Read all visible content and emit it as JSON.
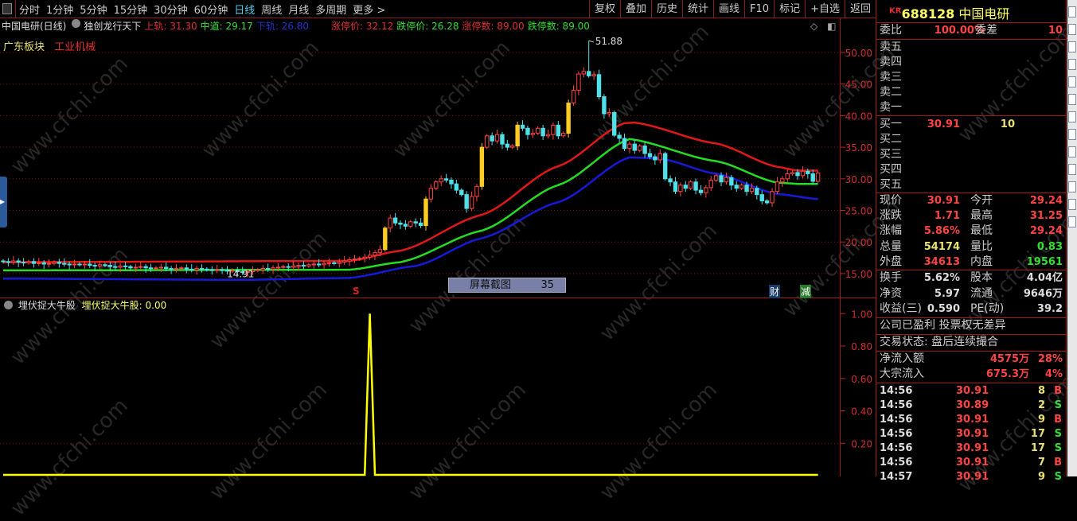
{
  "toolbar": {
    "periods": [
      "分时",
      "1分钟",
      "5分钟",
      "15分钟",
      "30分钟",
      "60分钟",
      "日线",
      "周线",
      "月线",
      "多周期",
      "更多 >"
    ],
    "active_period": "日线",
    "buttons": [
      "复权",
      "叠加",
      "历史",
      "统计",
      "画线",
      "F10",
      "标记",
      "+自选",
      "返回"
    ]
  },
  "legend": {
    "stock": "中国电研(日线)",
    "indicator": "独创龙行天下",
    "upper": "上轨: 31.30",
    "middle": "中道: 29.17",
    "lower": "下轨: 26.80",
    "limit_up": "涨停价: 32.12",
    "limit_down": "跌停价: 26.28",
    "limit_up_count": "涨停数: 89.00",
    "limit_down_count": "跌停数: 89.00"
  },
  "blocks": {
    "region": "广东板块",
    "industry": "工业机械"
  },
  "markers": {
    "s": "S",
    "screenshot_label": "屏幕截图",
    "screenshot_count": "35",
    "cai": "财",
    "jian": "减"
  },
  "lower_panel": {
    "name": "埋伏捉大牛股",
    "value_label": "埋伏捉大牛股: 0.00"
  },
  "watermark": "www.cfchi.com",
  "colors": {
    "up": "#ff4444",
    "down": "#4fe0e8",
    "big_up": "#ffcc22",
    "upper_band": "#e01818",
    "middle_band": "#22dd22",
    "lower_band": "#1818d8",
    "indicator": "#ffff00"
  },
  "chart_data": [
    {
      "type": "candlestick",
      "ylim": [
        13,
        53
      ],
      "y_ticks": [
        "50.00",
        "45.00",
        "40.00",
        "35.00",
        "30.00",
        "25.00",
        "20.00",
        "15.00"
      ],
      "close": [
        16.9,
        16.8,
        17.0,
        16.8,
        16.7,
        16.9,
        16.6,
        16.7,
        16.5,
        16.6,
        16.8,
        16.6,
        16.5,
        16.4,
        16.5,
        16.4,
        16.5,
        16.3,
        16.2,
        16.4,
        16.3,
        16.1,
        16.0,
        16.2,
        16.1,
        15.9,
        16.0,
        16.1,
        15.9,
        15.8,
        15.9,
        16.0,
        15.8,
        15.7,
        15.8,
        15.9,
        15.7,
        15.6,
        15.8,
        15.7,
        15.6,
        15.5,
        15.6,
        15.5,
        15.4,
        15.5,
        15.3,
        15.2,
        15.3,
        15.5,
        15.6,
        15.8,
        15.7,
        15.9,
        16.0,
        16.1,
        16.0,
        16.2,
        16.3,
        16.2,
        16.4,
        16.5,
        16.4,
        16.6,
        16.7,
        16.6,
        16.8,
        17.0,
        17.2,
        17.3,
        17.4,
        17.6,
        17.9,
        18.3,
        18.8,
        22.2,
        23.8,
        23.0,
        22.8,
        22.5,
        23.2,
        23.0,
        22.6,
        26.8,
        28.5,
        29.5,
        30.0,
        29.8,
        29.2,
        28.2,
        27.5,
        25.3,
        27.2,
        28.8,
        35.0,
        36.8,
        36.0,
        37.0,
        35.5,
        35.0,
        35.2,
        38.5,
        38.0,
        37.0,
        37.2,
        38.0,
        36.8,
        37.0,
        38.5,
        36.8,
        37.2,
        42.0,
        44.0,
        46.6,
        47.0,
        46.3,
        46.5,
        43.0,
        40.3,
        40.5,
        36.9,
        36.4,
        34.8,
        35.5,
        34.5,
        35.2,
        34.0,
        33.5,
        33.0,
        34.0,
        30.0,
        29.5,
        28.0,
        29.0,
        28.5,
        29.5,
        28.2,
        27.8,
        28.6,
        29.8,
        30.5,
        29.5,
        30.2,
        29.0,
        28.5,
        29.0,
        28.0,
        28.5,
        27.5,
        26.5,
        26.2,
        28.0,
        29.5,
        30.0,
        30.8,
        31.0,
        30.5,
        31.2,
        30.8,
        29.6,
        30.91
      ],
      "high_marker": {
        "index": 115,
        "value": 51.88,
        "label": "51.88"
      },
      "low_marker": {
        "index": 43,
        "value": 14.91,
        "label": "14.91"
      },
      "bands": {
        "upper": [
          [
            0,
            16.8
          ],
          [
            68,
            17.0
          ],
          [
            78,
            18.6
          ],
          [
            94,
            24.3
          ],
          [
            109,
            32
          ],
          [
            122,
            38.8
          ],
          [
            124,
            38.9
          ],
          [
            140,
            35.6
          ],
          [
            152,
            31.9
          ],
          [
            156,
            31.3
          ],
          [
            160,
            31.3
          ]
        ],
        "middle": [
          [
            0,
            15.5
          ],
          [
            68,
            15.6
          ],
          [
            78,
            16.8
          ],
          [
            94,
            21.8
          ],
          [
            109,
            29
          ],
          [
            123,
            36.3
          ],
          [
            140,
            32.8
          ],
          [
            152,
            29.4
          ],
          [
            156,
            29.2
          ],
          [
            160,
            29.2
          ]
        ],
        "lower": [
          [
            0,
            14.2
          ],
          [
            47,
            14.0
          ],
          [
            68,
            14.3
          ],
          [
            81,
            16.2
          ],
          [
            94,
            20.6
          ],
          [
            109,
            26.3
          ],
          [
            123,
            33.4
          ],
          [
            129,
            33.2
          ],
          [
            140,
            30.8
          ],
          [
            152,
            27.6
          ],
          [
            160,
            26.8
          ]
        ]
      }
    },
    {
      "type": "line",
      "ylim": [
        0,
        1.1
      ],
      "y_ticks": [
        "1.00",
        "0.80",
        "0.60",
        "0.40",
        "0.20"
      ],
      "spike_index": 72,
      "spike_value": 1.0
    }
  ],
  "quote": {
    "code_prefix": "KR",
    "code": "688128",
    "name": "中国电研",
    "weibi_label": "委比",
    "weibi": "100.00%",
    "weicha_label": "委差",
    "weicha": "10",
    "sell": [
      {
        "label": "卖五"
      },
      {
        "label": "卖四"
      },
      {
        "label": "卖三"
      },
      {
        "label": "卖二"
      },
      {
        "label": "卖一"
      }
    ],
    "buy": [
      {
        "label": "买一",
        "price": "30.91",
        "vol": "10"
      },
      {
        "label": "买二"
      },
      {
        "label": "买三"
      },
      {
        "label": "买四"
      },
      {
        "label": "买五"
      }
    ],
    "stats": [
      {
        "l": "现价",
        "v": "30.91",
        "c": "red",
        "l2": "今开",
        "v2": "29.24",
        "c2": "red"
      },
      {
        "l": "涨跌",
        "v": "1.71",
        "c": "red",
        "l2": "最高",
        "v2": "31.25",
        "c2": "red"
      },
      {
        "l": "涨幅",
        "v": "5.86%",
        "c": "red",
        "l2": "最低",
        "v2": "29.24",
        "c2": "red"
      },
      {
        "l": "总量",
        "v": "54174",
        "c": "yel",
        "l2": "量比",
        "v2": "0.83",
        "c2": "grn"
      },
      {
        "l": "外盘",
        "v": "34613",
        "c": "red",
        "l2": "内盘",
        "v2": "19561",
        "c2": "grn"
      }
    ],
    "finance": [
      {
        "l": "换手",
        "v": "5.62%",
        "l2": "股本",
        "v2": "4.04亿"
      },
      {
        "l": "净资",
        "v": "5.97",
        "l2": "流通",
        "v2": "9646万"
      },
      {
        "l": "收益(三)",
        "v": "0.590",
        "l2": "PE(动)",
        "v2": "39.2"
      }
    ],
    "profit_note": "公司已盈利 投票权无差异",
    "trade_status": "交易状态: 盘后连续撮合",
    "flows": [
      {
        "l": "净流入额",
        "v": "4575万",
        "p": "28%"
      },
      {
        "l": "大宗流入",
        "v": "675.3万",
        "p": "4%"
      }
    ],
    "ticks": [
      {
        "t": "14:56",
        "p": "30.91",
        "q": "8",
        "d": "B"
      },
      {
        "t": "14:56",
        "p": "30.89",
        "q": "2",
        "d": "S"
      },
      {
        "t": "14:56",
        "p": "30.91",
        "q": "9",
        "d": "B"
      },
      {
        "t": "14:56",
        "p": "30.91",
        "q": "17",
        "d": "S"
      },
      {
        "t": "14:56",
        "p": "30.91",
        "q": "17",
        "d": "S"
      },
      {
        "t": "14:56",
        "p": "30.91",
        "q": "7",
        "d": "B"
      },
      {
        "t": "14:57",
        "p": "30.91",
        "q": "9",
        "d": "S"
      }
    ]
  }
}
